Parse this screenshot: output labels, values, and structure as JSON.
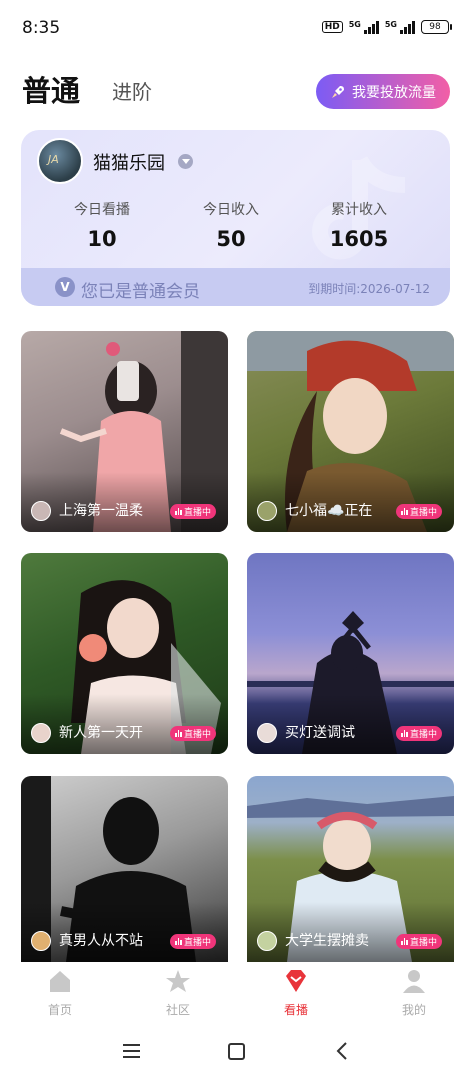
{
  "status_bar": {
    "time": "8:35",
    "hd_label": "HD",
    "network_1": "5G",
    "network_2": "5G",
    "battery": "98"
  },
  "header": {
    "tab_normal": "普通",
    "tab_advanced": "进阶",
    "promo_button": "我要投放流量"
  },
  "member_card": {
    "name": "猫猫乐园",
    "avatar_text": "JA",
    "stats": [
      {
        "label": "今日看播",
        "value": "10"
      },
      {
        "label": "今日收入",
        "value": "50"
      },
      {
        "label": "累计收入",
        "value": "1605"
      }
    ],
    "status": "您已是普通会员",
    "expiry": "到期时间:2026-07-12"
  },
  "live_badge": "直播中",
  "streams": [
    {
      "name": "上海第一温柔"
    },
    {
      "name": "七小福☁️正在"
    },
    {
      "name": "新人第一天开"
    },
    {
      "name": "买灯送调试"
    },
    {
      "name": "真男人从不站"
    },
    {
      "name": "大学生摆摊卖"
    }
  ],
  "bottom_nav": [
    {
      "label": "首页",
      "icon": "home-icon"
    },
    {
      "label": "社区",
      "icon": "star-icon"
    },
    {
      "label": "看播",
      "icon": "diamond-icon"
    },
    {
      "label": "我的",
      "icon": "person-icon"
    }
  ],
  "colors": {
    "accent": "#e8343a",
    "badge": "#f0357a",
    "promo_start": "#7c5cf4",
    "promo_end": "#f25fa6"
  }
}
